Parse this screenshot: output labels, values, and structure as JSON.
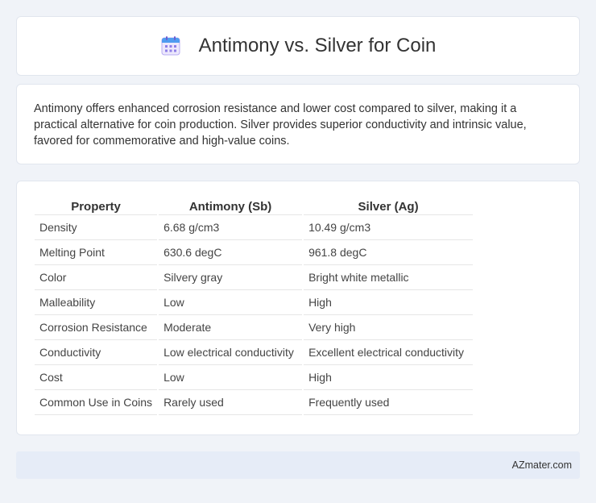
{
  "header": {
    "title": "Antimony vs. Silver for Coin",
    "icon": "calendar-icon"
  },
  "summary": {
    "text": "Antimony offers enhanced corrosion resistance and lower cost compared to silver, making it a practical alternative for coin production. Silver provides superior conductivity and intrinsic value, favored for commemorative and high-value coins."
  },
  "table": {
    "headers": [
      "Property",
      "Antimony (Sb)",
      "Silver (Ag)"
    ],
    "rows": [
      [
        "Density",
        "6.68 g/cm3",
        "10.49 g/cm3"
      ],
      [
        "Melting Point",
        "630.6 degC",
        "961.8 degC"
      ],
      [
        "Color",
        "Silvery gray",
        "Bright white metallic"
      ],
      [
        "Malleability",
        "Low",
        "High"
      ],
      [
        "Corrosion Resistance",
        "Moderate",
        "Very high"
      ],
      [
        "Conductivity",
        "Low electrical conductivity",
        "Excellent electrical conductivity"
      ],
      [
        "Cost",
        "Low",
        "High"
      ],
      [
        "Common Use in Coins",
        "Rarely used",
        "Frequently used"
      ]
    ]
  },
  "footer": {
    "brand": "AZmater.com"
  },
  "colors": {
    "background": "#f0f3f8",
    "card": "#ffffff",
    "footer": "#e6ecf7",
    "icon_primary": "#8f7fe8",
    "icon_header": "#4f9cf0"
  }
}
